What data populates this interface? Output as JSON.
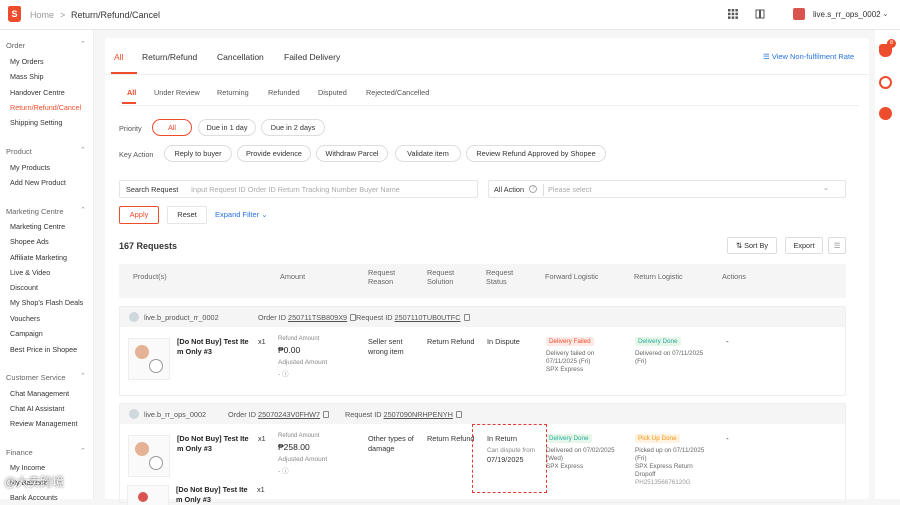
{
  "topbar": {
    "home": "Home",
    "separator": ">",
    "page": "Return/Refund/Cancel",
    "shop_name": "live.s_rr_ops_0002"
  },
  "sidebar": {
    "sections": [
      {
        "title": "Order",
        "items": [
          "My Orders",
          "Mass Ship",
          "Handover Centre",
          "Return/Refund/Cancel",
          "Shipping Setting"
        ]
      },
      {
        "title": "Product",
        "items": [
          "My Products",
          "Add New Product"
        ]
      },
      {
        "title": "Marketing Centre",
        "items": [
          "Marketing Centre",
          "Shopee Ads",
          "Affiliate Marketing",
          "Live & Video",
          "Discount",
          "My Shop's Flash Deals",
          "Vouchers",
          "Campaign",
          "Best Price in Shopee"
        ]
      },
      {
        "title": "Customer Service",
        "items": [
          "Chat Management",
          "Chat AI Assistant",
          "Review Management"
        ]
      },
      {
        "title": "Finance",
        "items": [
          "My Income",
          "My Balance",
          "Bank Accounts"
        ]
      }
    ]
  },
  "tabs": [
    "All",
    "Return/Refund",
    "Cancellation",
    "Failed Delivery"
  ],
  "view_rate": "View Non-fulfilment Rate",
  "subtabs": [
    "All",
    "Under Review",
    "Returning",
    "Refunded",
    "Disputed",
    "Rejected/Cancelled"
  ],
  "priority": {
    "label": "Priority",
    "options": [
      "All",
      "Due in 1 day",
      "Due in 2 days"
    ]
  },
  "key_action": {
    "label": "Key Action",
    "options": [
      "Reply to buyer",
      "Provide evidence",
      "Withdraw Parcel",
      "Validate item",
      "Review Refund Approved by Shopee"
    ]
  },
  "search": {
    "label": "Search Request",
    "placeholder": "Input Request ID Order ID Return Tracking Number Buyer Name"
  },
  "action_filter": {
    "label": "All Action",
    "placeholder": "Please select"
  },
  "buttons": {
    "apply": "Apply",
    "reset": "Reset",
    "expand": "Expand Filter",
    "sort": "Sort By",
    "export": "Export"
  },
  "count": "167 Requests",
  "table_headers": {
    "product": "Product(s)",
    "amount": "Amount",
    "reason": [
      "Request",
      "Reason"
    ],
    "solution": [
      "Request",
      "Solution"
    ],
    "status": [
      "Request",
      "Status"
    ],
    "forward": "Forward Logistic",
    "return": "Return Logistic",
    "actions": "Actions"
  },
  "requests": [
    {
      "user": "live.b_product_rr_0002",
      "order_label": "Order ID",
      "order_id": "250711TSB809X9",
      "request_label": "Request ID",
      "request_id": "2507110TUB0UTFC",
      "product_lines": [
        "[Do Not Buy] Test Ite",
        "m Only #3"
      ],
      "qty": "x1",
      "refund_label": "Refund Amount",
      "amount": "₱0.00",
      "adjusted_label": "Adjusted Amount",
      "adjusted_value": "-",
      "reason_lines": [
        "Seller sent",
        "wrong item"
      ],
      "solution": "Return Refund",
      "status": "In Dispute",
      "forward_badge": "Delivery Failed",
      "forward_info": [
        "Delivery failed on",
        "07/11/2025 (Fri)",
        "SPX Express"
      ],
      "return_badge": "Delivery Done",
      "return_info": [
        "Delivered on 07/11/2025",
        "(Fri)"
      ],
      "action": "-"
    },
    {
      "user": "live.b_rr_ops_0002",
      "order_label": "Order ID",
      "order_id": "25070243V0FHW7",
      "request_label": "Request ID",
      "request_id": "2507090NRHPENYH",
      "product_lines": [
        "[Do Not Buy] Test Ite",
        "m Only #3"
      ],
      "qty": "x1",
      "refund_label": "Refund Amount",
      "amount": "₱258.00",
      "adjusted_label": "Adjusted Amount",
      "adjusted_value": "-",
      "reason_lines": [
        "Other types of",
        "damage"
      ],
      "solution": "Return Refund",
      "status": "In Return",
      "dispute_label": "Can dispute from",
      "dispute_date": "07/19/2025",
      "forward_badge": "Delivery Done",
      "forward_info": [
        "Delivered on 07/02/2025",
        "(Wed)",
        "SPX Express"
      ],
      "return_badge": "Pick Up Done",
      "return_info": [
        "Picked up on 07/11/2025",
        "(Fri)",
        "SPX Express Return",
        "Dropoff",
        "PH251356676120G"
      ],
      "action": "-"
    }
  ],
  "third_row": {
    "product_lines": [
      "[Do Not Buy] Test Ite",
      "m Only #3"
    ],
    "qty": "x1"
  },
  "notifications": "8",
  "watermark": "@大卖跨境"
}
